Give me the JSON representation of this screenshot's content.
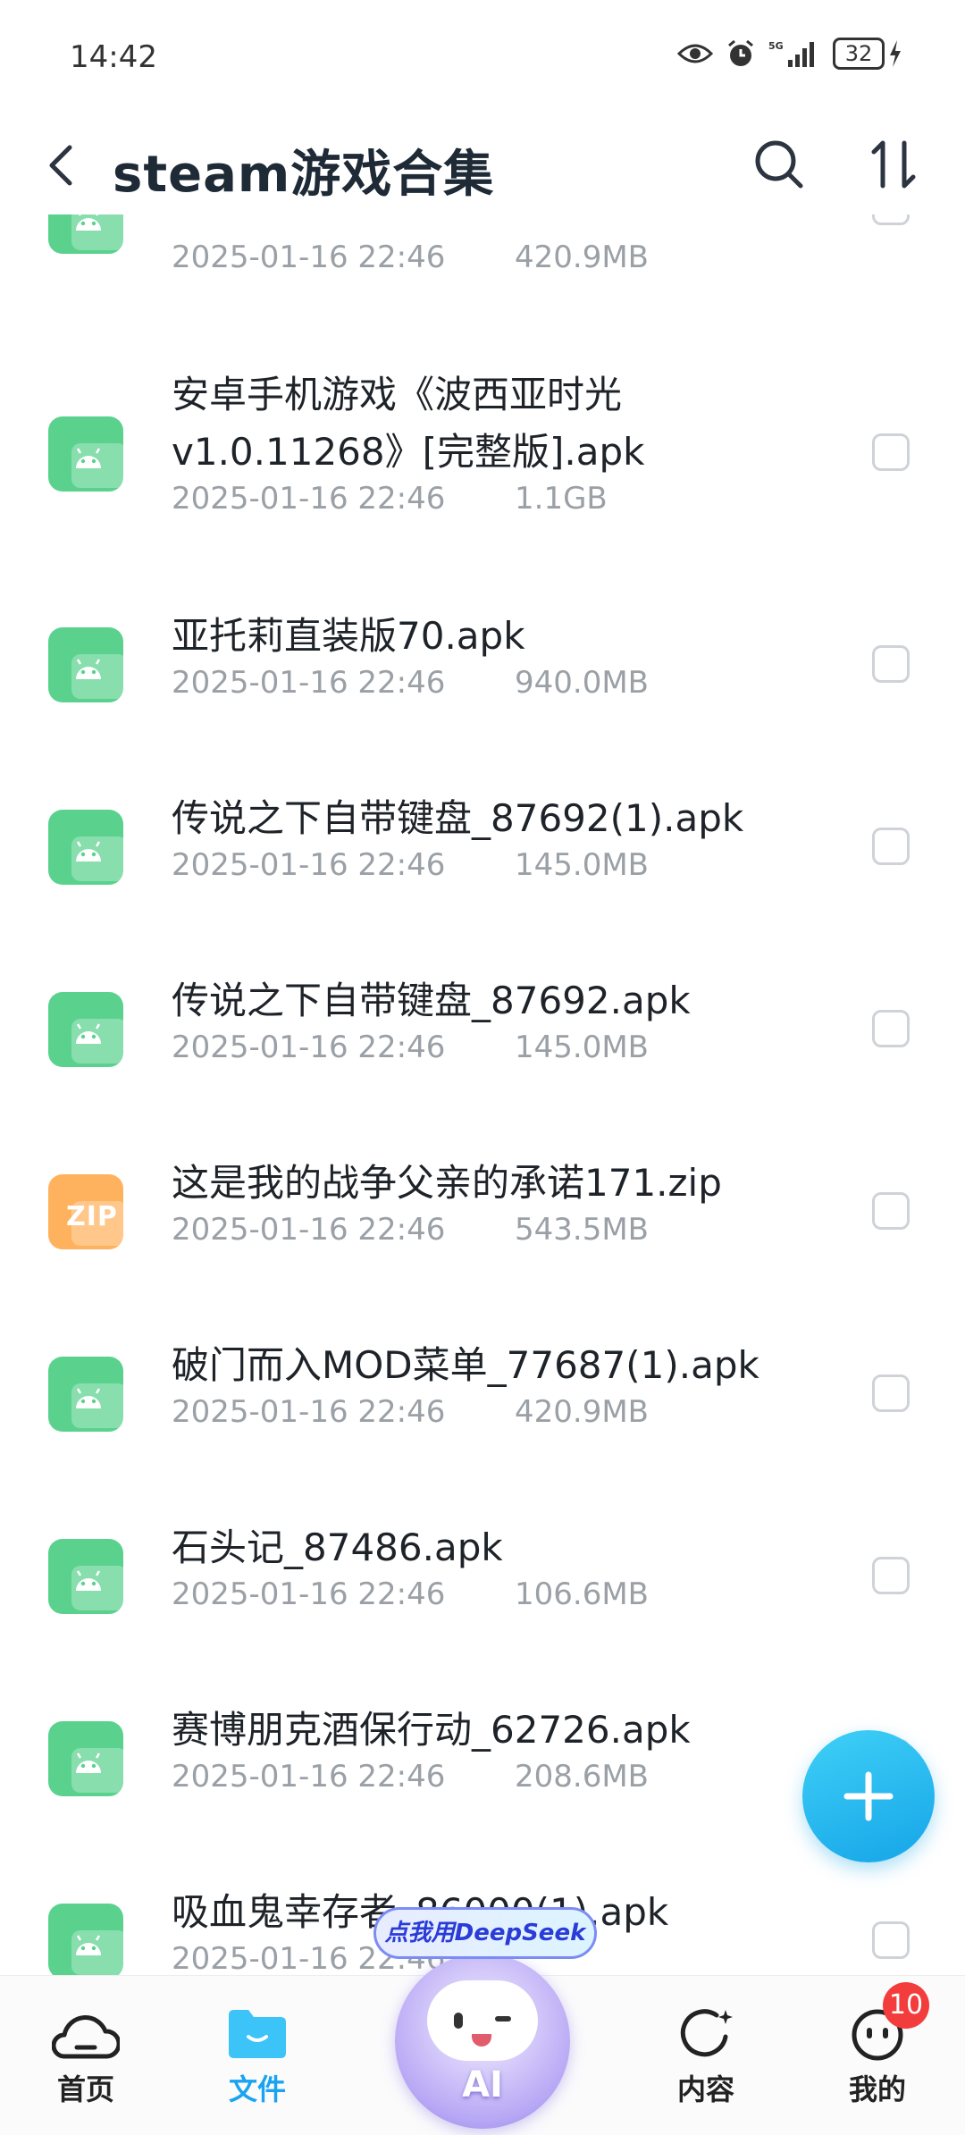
{
  "status_bar": {
    "time": "14:42",
    "network": "5G",
    "battery": "32"
  },
  "header": {
    "title": "steam游戏合集"
  },
  "files": [
    {
      "name": "",
      "date": "2025-01-16 22:46",
      "size": "420.9MB",
      "type": "apk"
    },
    {
      "name": "安卓手机游戏《波西亚时光v1.0.11268》[完整版].apk",
      "date": "2025-01-16 22:46",
      "size": "1.1GB",
      "type": "apk"
    },
    {
      "name": "亚托莉直装版70.apk",
      "date": "2025-01-16 22:46",
      "size": "940.0MB",
      "type": "apk"
    },
    {
      "name": "传说之下自带键盘_87692(1).apk",
      "date": "2025-01-16 22:46",
      "size": "145.0MB",
      "type": "apk"
    },
    {
      "name": "传说之下自带键盘_87692.apk",
      "date": "2025-01-16 22:46",
      "size": "145.0MB",
      "type": "apk"
    },
    {
      "name": "这是我的战争父亲的承诺171.zip",
      "date": "2025-01-16 22:46",
      "size": "543.5MB",
      "type": "zip"
    },
    {
      "name": "破门而入MOD菜单_77687(1).apk",
      "date": "2025-01-16 22:46",
      "size": "420.9MB",
      "type": "apk"
    },
    {
      "name": "石头记_87486.apk",
      "date": "2025-01-16 22:46",
      "size": "106.6MB",
      "type": "apk"
    },
    {
      "name": "赛博朋克酒保行动_62726.apk",
      "date": "2025-01-16 22:46",
      "size": "208.6MB",
      "type": "apk"
    },
    {
      "name": "吸血鬼幸存者_86000(1).apk",
      "date": "2025-01-16 22:46",
      "size": "",
      "type": "apk"
    }
  ],
  "zip_icon_label": "ZIP",
  "ai_promo": {
    "bubble": "点我用DeepSeek",
    "label": "AI"
  },
  "tabs": [
    {
      "label": "首页",
      "active": false
    },
    {
      "label": "文件",
      "active": true
    },
    {
      "label": "内容",
      "active": false
    },
    {
      "label": "我的",
      "active": false
    }
  ],
  "badge_count": "10",
  "colors": {
    "accent": "#1aa3f0",
    "apk_icon": "#5ad28e",
    "zip_icon": "#ffb25e",
    "badge": "#f33c3c"
  }
}
